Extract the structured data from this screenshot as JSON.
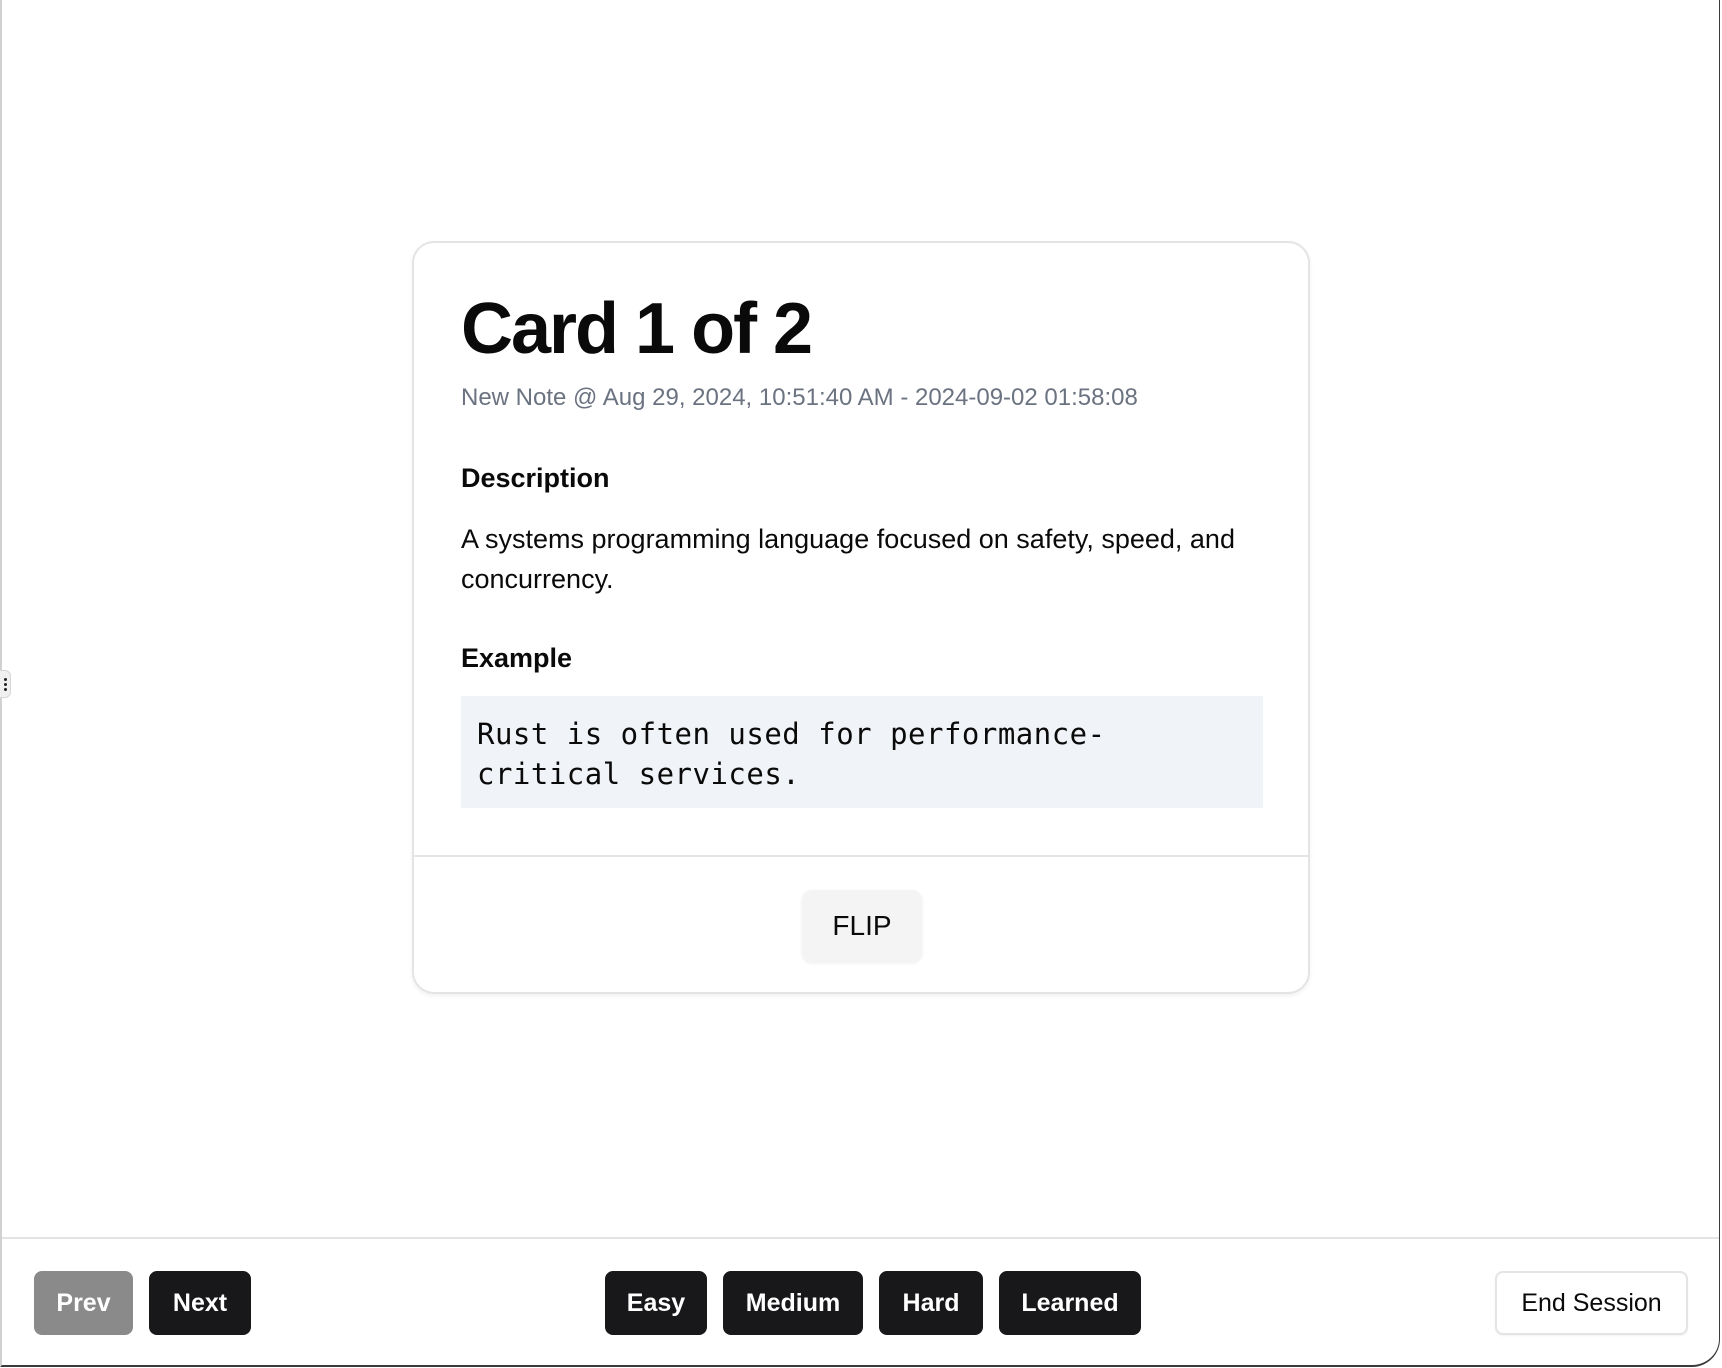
{
  "card": {
    "title": "Card 1 of 2",
    "subtitle": "New Note @ Aug 29, 2024, 10:51:40 AM - 2024-09-02 01:58:08",
    "description_heading": "Description",
    "description_text": "A systems programming language focused on safety, speed, and concurrency.",
    "example_heading": "Example",
    "example_code": "Rust is often used for performance-\ncritical services.",
    "flip_label": "FLIP"
  },
  "navigation": {
    "prev_label": "Prev",
    "next_label": "Next"
  },
  "rating": {
    "easy_label": "Easy",
    "medium_label": "Medium",
    "hard_label": "Hard",
    "learned_label": "Learned"
  },
  "session": {
    "end_label": "End Session"
  },
  "colors": {
    "primary_button": "#18181b",
    "disabled_button": "#8a8a8a",
    "code_background": "#f0f3f7",
    "muted_text": "#6b7280"
  },
  "icons": {
    "drag_handle": "vertical-dots-icon"
  }
}
